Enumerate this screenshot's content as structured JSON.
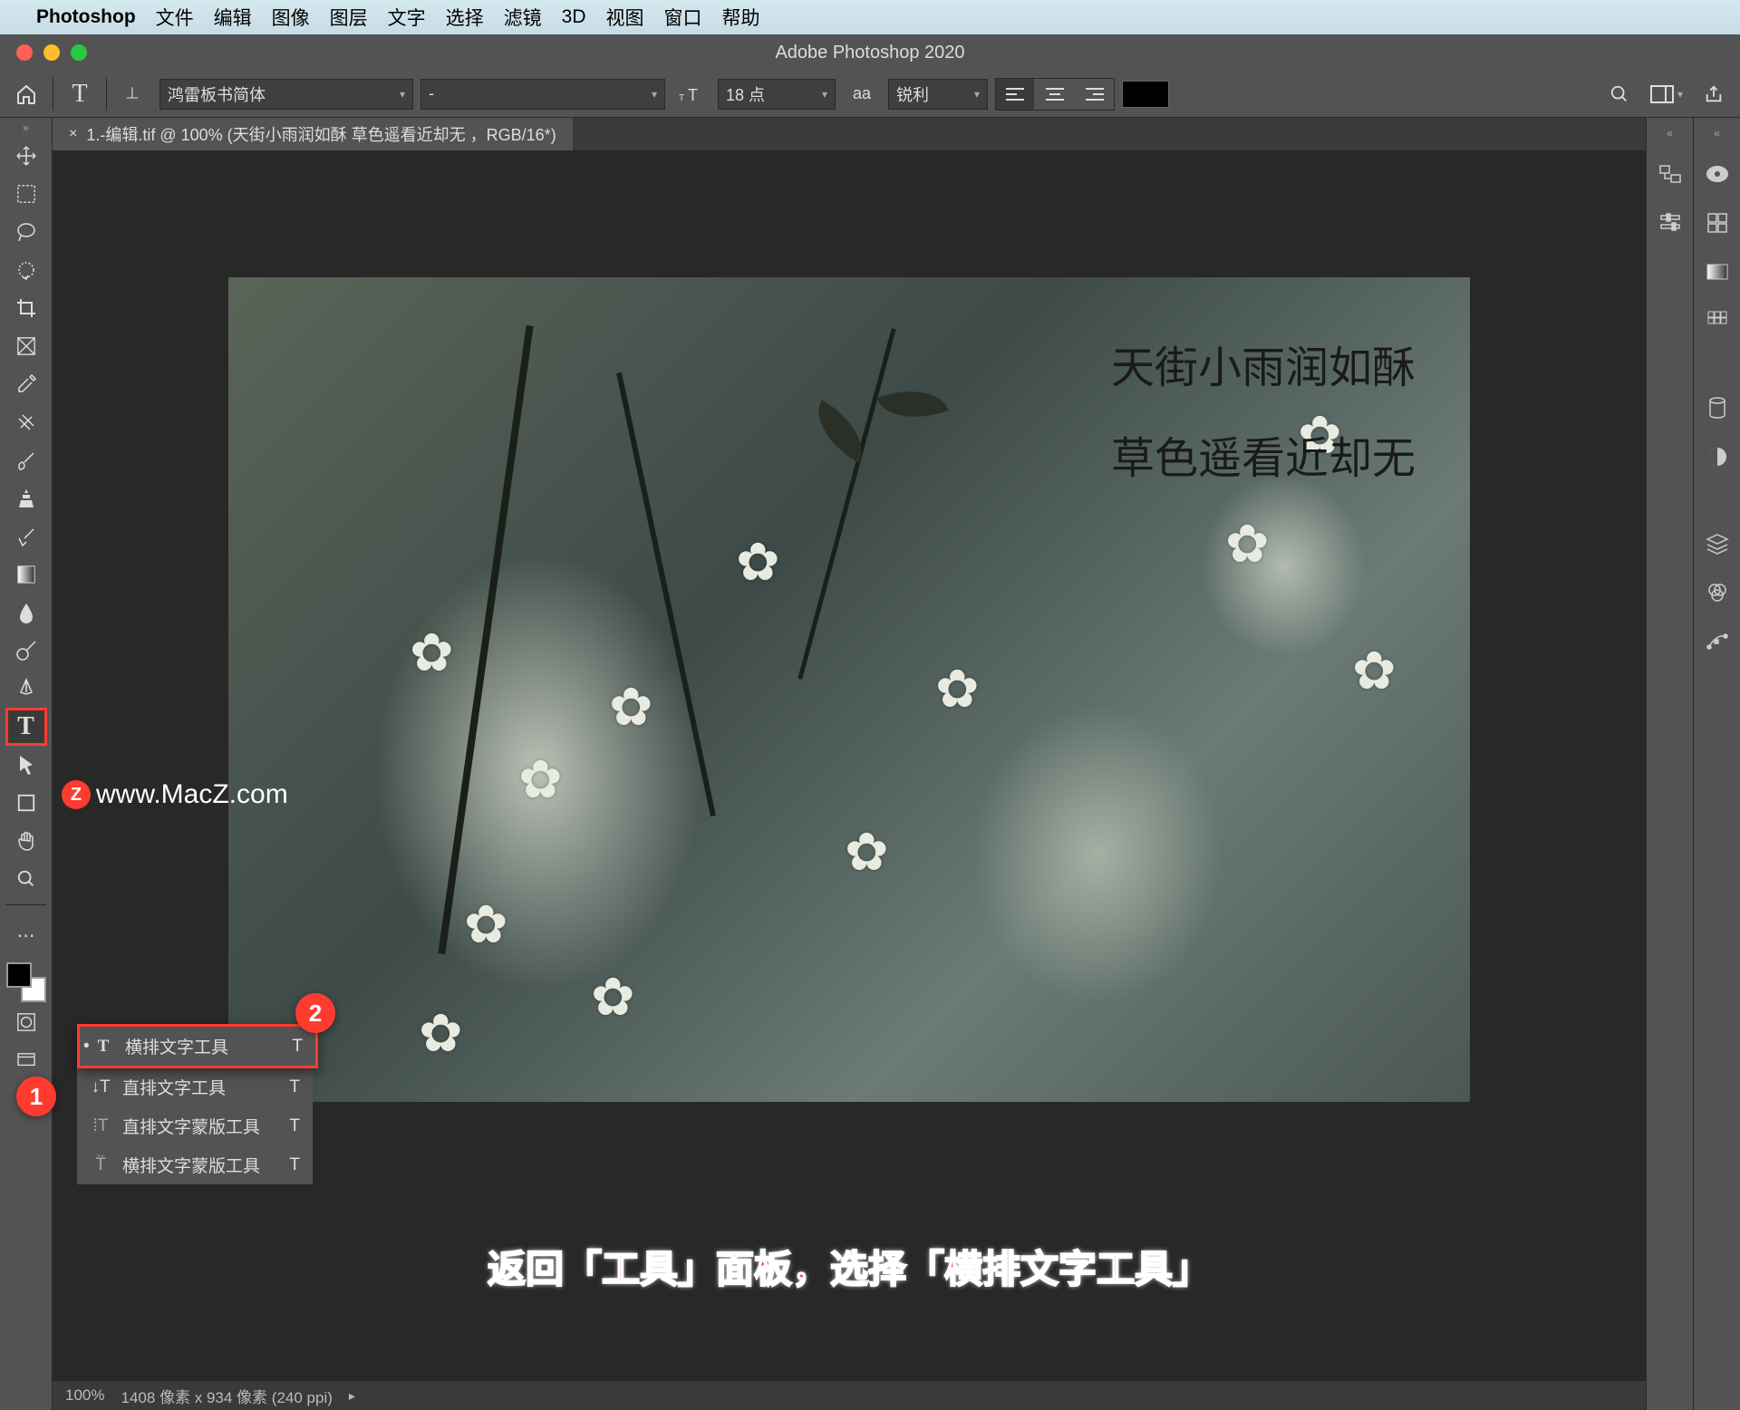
{
  "menubar": {
    "app_name": "Photoshop",
    "items": [
      "文件",
      "编辑",
      "图像",
      "图层",
      "文字",
      "选择",
      "滤镜",
      "3D",
      "视图",
      "窗口",
      "帮助"
    ]
  },
  "window": {
    "title": "Adobe Photoshop 2020"
  },
  "options": {
    "font_family": "鸿雷板书简体",
    "font_style": "-",
    "font_size": "18 点",
    "aa_label": "锐利",
    "aa_prefix": "aa"
  },
  "document": {
    "tab_label": "1.-编辑.tif @ 100% (天街小雨润如酥 草色遥看近却无 ，RGB/16*)",
    "text_line1": "天街小雨润如酥",
    "text_line2": "草色遥看近却无"
  },
  "watermark": {
    "icon_letter": "Z",
    "text": "www.MacZ.com"
  },
  "flyout": {
    "items": [
      {
        "label": "横排文字工具",
        "key": "T",
        "active": true
      },
      {
        "label": "直排文字工具",
        "key": "T",
        "active": false
      },
      {
        "label": "直排文字蒙版工具",
        "key": "T",
        "active": false
      },
      {
        "label": "横排文字蒙版工具",
        "key": "T",
        "active": false
      }
    ]
  },
  "badges": {
    "b1": "1",
    "b2": "2"
  },
  "caption": "返回「工具」面板，选择「横排文字工具」",
  "status": {
    "zoom": "100%",
    "dims": "1408 像素 x 934 像素 (240 ppi)"
  }
}
